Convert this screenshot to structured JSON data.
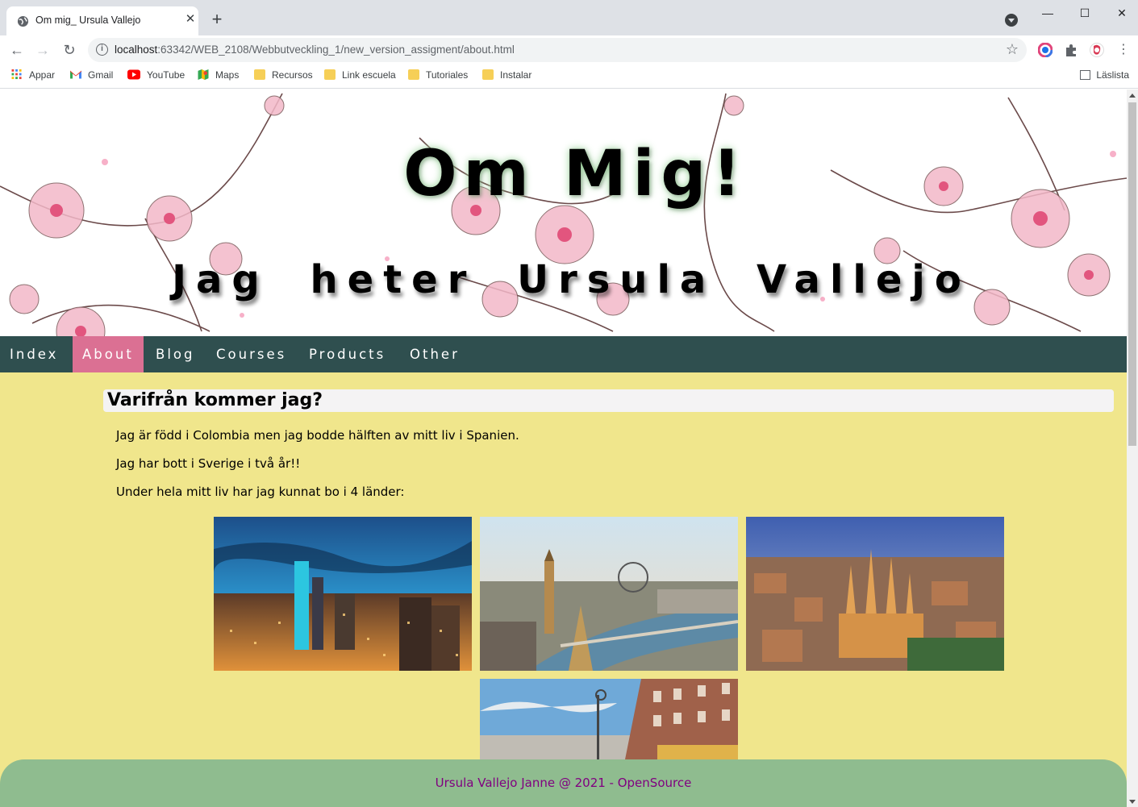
{
  "browser": {
    "tab_title": "Om mig_ Ursula Vallejo",
    "url_host": "localhost",
    "url_rest": ":63342/WEB_2108/Webbutveckling_1/new_version_assigment/about.html",
    "new_tab_label": "+",
    "bookmarks": [
      "Appar",
      "Gmail",
      "YouTube",
      "Maps",
      "Recursos",
      "Link escuela",
      "Tutoriales",
      "Instalar"
    ],
    "reading_list": "Läslista"
  },
  "page": {
    "hero_title": "Om Mig!",
    "hero_subtitle": "Jag heter Ursula Vallejo",
    "nav": [
      "Index",
      "About",
      "Blog",
      "Courses",
      "Products",
      "Other"
    ],
    "active_nav": "About",
    "heading": "Varifrån kommer jag?",
    "paragraphs": [
      "Jag är född i Colombia men jag bodde hälften av mitt liv i Spanien.",
      "Jag har bott i Sverige i två år!!",
      "Under hela mitt liv har jag kunnat bo i 4 länder:"
    ],
    "footer": "Ursula Vallejo Janne @ 2021 - OpenSource"
  },
  "colors": {
    "background": "#f0e68c",
    "nav_bg": "#2f4f4f",
    "nav_active": "#db7093",
    "footer_bg": "#8fbc8f",
    "footer_text": "#800080"
  }
}
